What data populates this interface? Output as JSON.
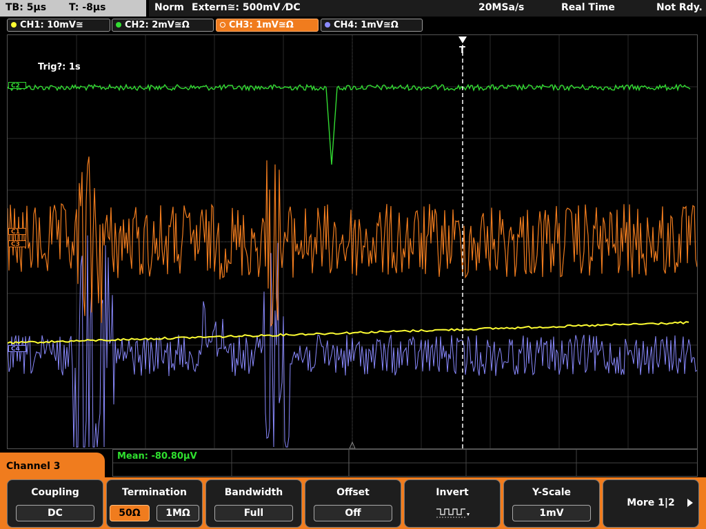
{
  "topbar": {
    "timebase": "TB: 5µs",
    "trigger_time": "T: -8µs",
    "mode": "Norm",
    "trigger_source": "Extern≅: 500mV ⁄DC",
    "sample_rate": "20MSa/s",
    "acq_mode": "Real Time",
    "status": "Not Rdy."
  },
  "channels": [
    {
      "label": "CH1: 10mV≅",
      "color": "#ffff33"
    },
    {
      "label": "CH2: 2mV≅Ω",
      "color": "#33dd33"
    },
    {
      "label": "CH3: 1mV≅Ω",
      "color": "#f07c1e"
    },
    {
      "label": "CH4: 1mV≅Ω",
      "color": "#8a8aff"
    }
  ],
  "trigger_message": "Trig?: 1s",
  "markers": {
    "c2": "C2",
    "c1": "C1",
    "c3": "C3",
    "c4": "C4"
  },
  "measurement": {
    "text": "Mean: -80.80µV"
  },
  "channel_menu": {
    "title": "Channel 3"
  },
  "softkeys": {
    "coupling": {
      "title": "Coupling",
      "value": "DC"
    },
    "termination": {
      "title": "Termination",
      "opt1": "50Ω",
      "opt2": "1MΩ"
    },
    "bandwidth": {
      "title": "Bandwidth",
      "value": "Full"
    },
    "offset": {
      "title": "Offset",
      "value": "Off"
    },
    "invert": {
      "title": "Invert"
    },
    "yscale": {
      "title": "Y-Scale",
      "value": "1mV"
    },
    "more": {
      "label": "More 1|2"
    }
  }
}
